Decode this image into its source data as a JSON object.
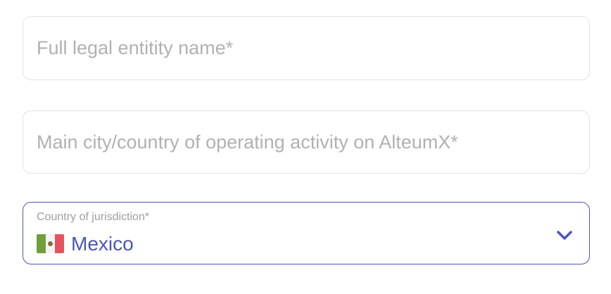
{
  "form": {
    "legal_name": {
      "placeholder": "Full legal entitity name*",
      "value": ""
    },
    "operating_location": {
      "placeholder": "Main city/country of operating activity on AlteumX*",
      "value": ""
    },
    "jurisdiction": {
      "label": "Country of jurisdiction*",
      "selected_value": "Mexico",
      "flag_icon": "mexico-flag-icon",
      "dropdown_icon": "chevron-down-icon"
    }
  },
  "colors": {
    "accent": "#4a56b8",
    "border": "#e3e3e3",
    "placeholder": "#b1b1b1",
    "label": "#9e9e9e"
  }
}
